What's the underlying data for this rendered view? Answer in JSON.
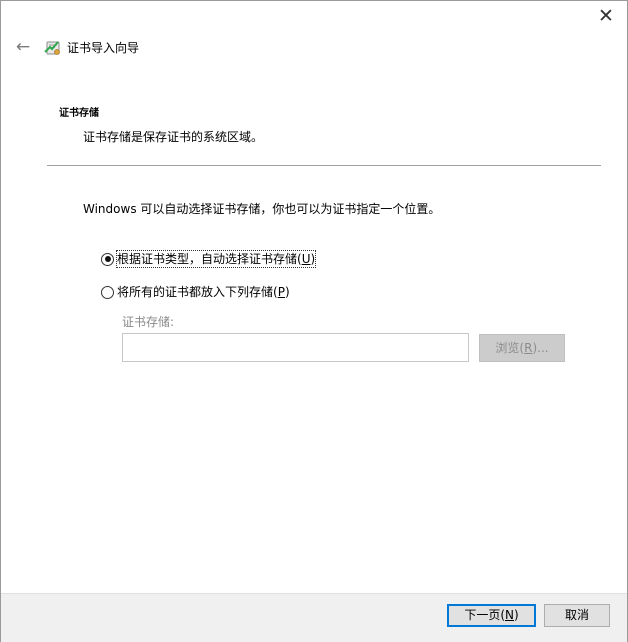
{
  "window": {
    "close_glyph": "✕",
    "back_glyph": "←",
    "title": "证书导入向导",
    "title_icon": "certificate-wizard-icon"
  },
  "section": {
    "title": "证书存储",
    "description": "证书存储是保存证书的系统区域。"
  },
  "content": {
    "intro": "Windows 可以自动选择证书存储，你也可以为证书指定一个位置。",
    "options": [
      {
        "label_prefix": "根据证书类型，自动选择证书存储(",
        "accel": "U",
        "label_suffix": ")",
        "selected": true
      },
      {
        "label_prefix": "将所有的证书都放入下列存储(",
        "accel": "P",
        "label_suffix": ")",
        "selected": false
      }
    ],
    "store_label": "证书存储:",
    "store_value": "",
    "browse_prefix": "浏览(",
    "browse_accel": "R",
    "browse_suffix": ")..."
  },
  "footer": {
    "next_prefix": "下一页(",
    "next_accel": "N",
    "next_suffix": ")",
    "cancel": "取消"
  },
  "colors": {
    "focus_border": "#0078d7",
    "disabled_text": "#8c8c8c",
    "footer_bg": "#f0f0f0"
  }
}
